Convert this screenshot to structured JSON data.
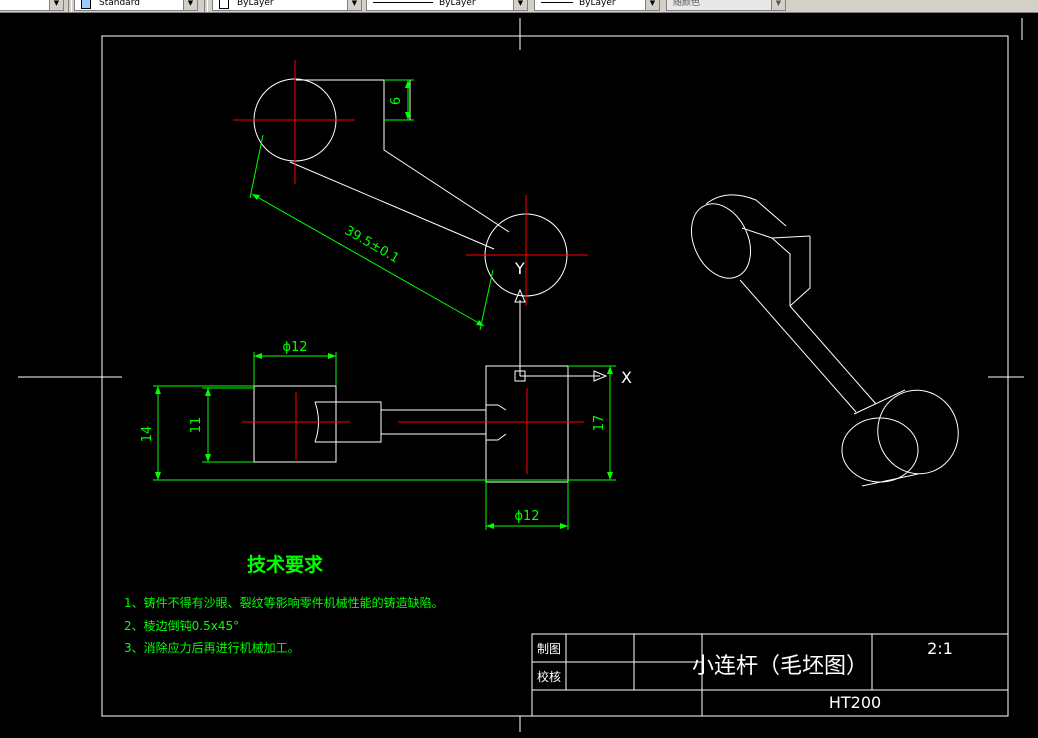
{
  "toolbar": {
    "textstyle_value": "Standard",
    "layer_value": "ByLayer",
    "linetype_value": "ByLayer",
    "lineweight_value": "ByLayer",
    "color_value": "随颜色"
  },
  "drawing": {
    "dimensions": {
      "center_distance": "39.5±0.1",
      "boss_height": "6",
      "diameter_top": "ϕ12",
      "diameter_bottom": "ϕ12",
      "height_left_outer": "14",
      "height_left_inner": "11",
      "height_right": "17"
    },
    "ucs": {
      "x_label": "X",
      "y_label": "Y"
    },
    "tech_requirements": {
      "title": "技术要求",
      "items": [
        "1、铸件不得有沙眼、裂纹等影响零件机械性能的铸造缺陷。",
        "2、棱边倒钝0.5x45°",
        "3、消除应力后再进行机械加工。"
      ]
    },
    "title_block": {
      "drawn_label": "制图",
      "checked_label": "校核",
      "part_name": "小连杆（毛坯图）",
      "scale": "2:1",
      "material": "HT200"
    }
  },
  "colors": {
    "background": "#000000",
    "outline": "#ffffff",
    "dimension": "#00ff00",
    "centerline": "#ff0000"
  }
}
